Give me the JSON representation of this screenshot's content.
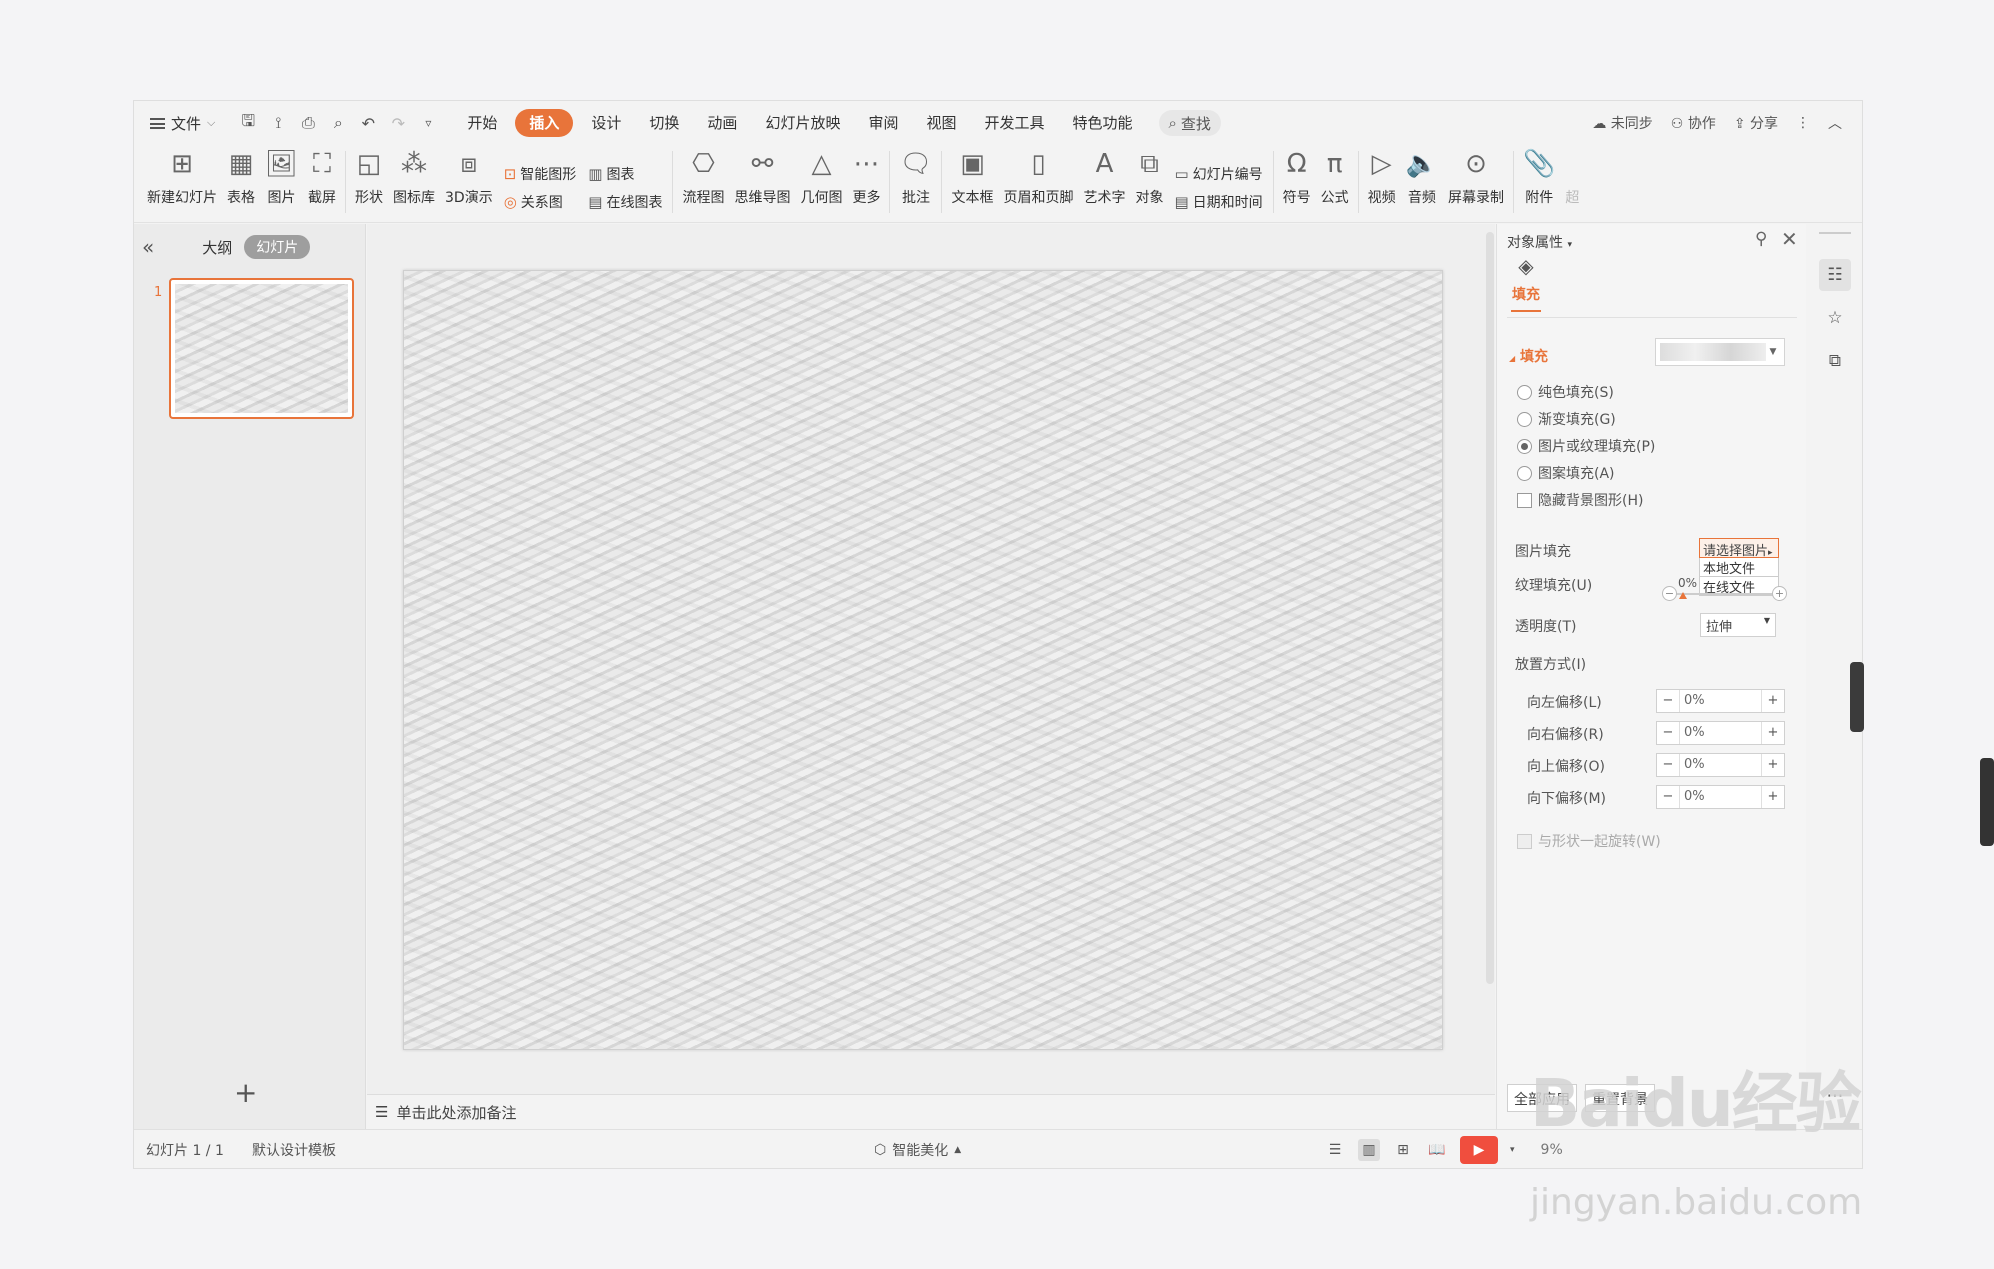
{
  "menubar": {
    "file": "文件",
    "tabs": [
      "开始",
      "插入",
      "设计",
      "切换",
      "动画",
      "幻灯片放映",
      "审阅",
      "视图",
      "开发工具",
      "特色功能"
    ],
    "active_tab": "插入",
    "search": "查找",
    "right": {
      "sync": "未同步",
      "collab": "协作",
      "share": "分享"
    }
  },
  "ribbon": {
    "new_slide": "新建幻灯片",
    "table": "表格",
    "picture": "图片",
    "screenshot": "截屏",
    "shape": "形状",
    "icon_lib": "图标库",
    "demo3d": "3D演示",
    "smart_shape": "智能图形",
    "relation": "关系图",
    "chart": "图表",
    "online_chart": "在线图表",
    "flowchart": "流程图",
    "mindmap": "思维导图",
    "geometry": "几何图",
    "more": "更多",
    "comment": "批注",
    "textbox": "文本框",
    "header_footer": "页眉和页脚",
    "wordart": "艺术字",
    "object": "对象",
    "slide_number": "幻灯片编号",
    "date_time": "日期和时间",
    "symbol": "符号",
    "formula": "公式",
    "video": "视频",
    "audio": "音频",
    "screen_record": "屏幕录制",
    "attachment": "附件",
    "hyperlink": "超"
  },
  "left_panel": {
    "outline": "大纲",
    "slides": "幻灯片",
    "slide_number": "1",
    "add": "+"
  },
  "notes": "单击此处添加备注",
  "status": {
    "slide_counter": "幻灯片 1 / 1",
    "template": "默认设计模板",
    "smart_beautify": "智能美化",
    "zoom": "9%"
  },
  "props": {
    "title": "对象属性",
    "tab": "填充",
    "section": "填充",
    "options": [
      {
        "label": "纯色填充(S)",
        "checked": false
      },
      {
        "label": "渐变填充(G)",
        "checked": false
      },
      {
        "label": "图片或纹理填充(P)",
        "checked": true
      },
      {
        "label": "图案填充(A)",
        "checked": false
      }
    ],
    "hide_bg": "隐藏背景图形(H)",
    "picture_fill": "图片填充",
    "texture_fill": "纹理填充(U)",
    "picker": {
      "header": "请选择图片",
      "menu": [
        "本地文件",
        "在线文件"
      ]
    },
    "transparency": "透明度(T)",
    "transparency_value": "0%",
    "placement": "放置方式(I)",
    "placement_value": "拉伸",
    "offsets": [
      {
        "label": "向左偏移(L)",
        "value": "0%"
      },
      {
        "label": "向右偏移(R)",
        "value": "0%"
      },
      {
        "label": "向上偏移(O)",
        "value": "0%"
      },
      {
        "label": "向下偏移(M)",
        "value": "0%"
      }
    ],
    "rotate_with_shape": "与形状一起旋转(W)",
    "apply_all": "全部应用",
    "reset_bg": "重置背景"
  },
  "watermark": {
    "brand": "Baidu经验",
    "url": "jingyan.baidu.com"
  }
}
